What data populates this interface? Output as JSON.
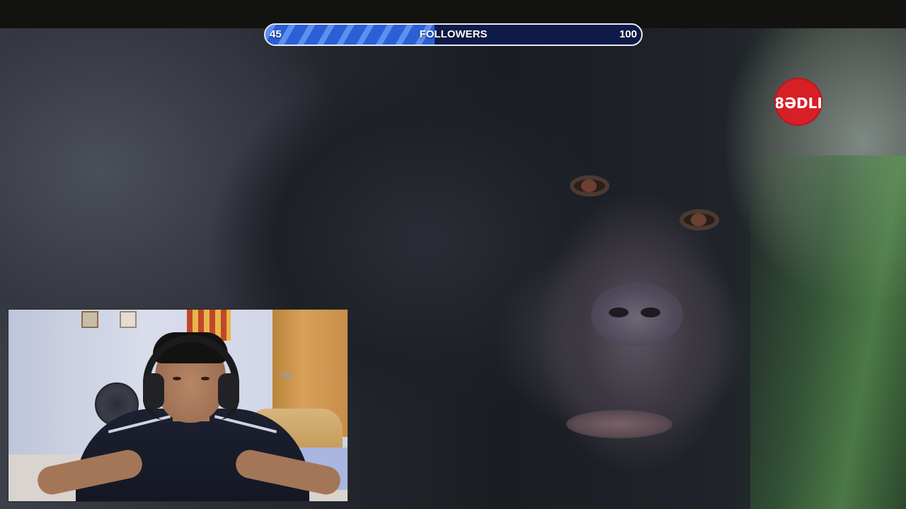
{
  "stream_overlay": {
    "follower_goal": {
      "current_label": "45",
      "title": "FOLLOWERS",
      "target_label": "100",
      "progress_fraction": 0.45
    },
    "channel_logo": {
      "icon": "channel-logo-icon",
      "text": "8ƏDLI",
      "color": "#d71f26"
    }
  },
  "scene": {
    "main_video": "chimpanzee close-up"
  },
  "webcam": {
    "icon": "webcam-feed"
  },
  "colors": {
    "progress_fill": "#2a5fd6",
    "progress_track": "#0e1a4a",
    "logo_red": "#d71f26"
  }
}
